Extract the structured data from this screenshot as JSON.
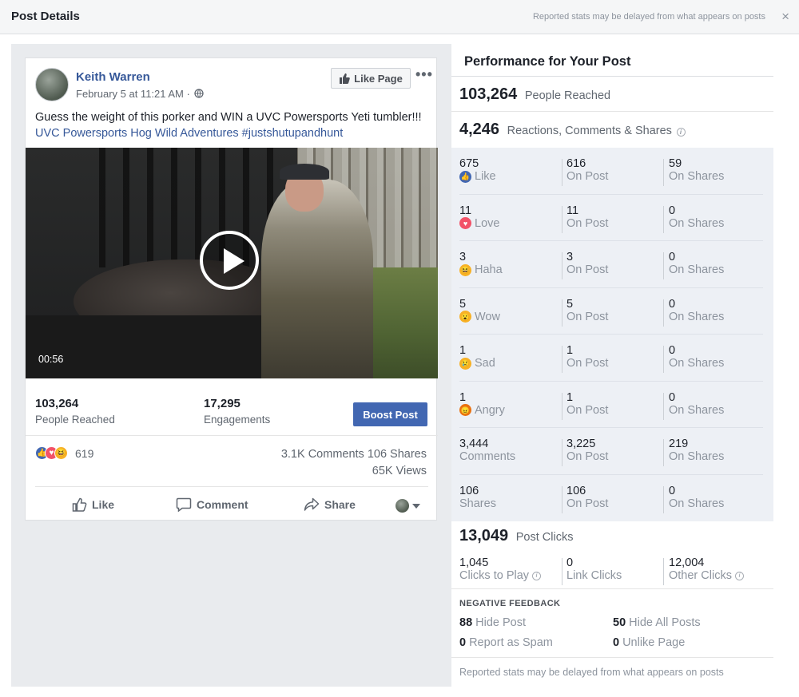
{
  "dialog": {
    "title": "Post Details",
    "header_note": "Reported stats may be delayed from what appears on posts",
    "close_glyph": "×"
  },
  "post": {
    "page_name": "Keith Warren",
    "date": "February 5 at 11:21 AM ·",
    "like_page_label": "Like Page",
    "more_glyph": "•••",
    "text": "Guess the weight of this porker and WIN a UVC Powersports Yeti tumbler!!!",
    "link_text": "UVC Powersports Hog Wild Adventures #justshutupandhunt",
    "video_time": "00:56",
    "people_reached_num": "103,264",
    "people_reached_label": "People Reached",
    "engagements_num": "17,295",
    "engagements_label": "Engagements",
    "boost_label": "Boost Post",
    "reaction_count": "619",
    "comments_shares": "3.1K Comments  106 Shares",
    "views": "65K Views",
    "actions": {
      "like": "Like",
      "comment": "Comment",
      "share": "Share"
    },
    "icons": [
      "globe-icon",
      "thumbs-up-icon",
      "comment-icon",
      "share-icon",
      "play-icon"
    ]
  },
  "performance": {
    "title": "Performance for Your Post",
    "reached_num": "103,264",
    "reached_label": "People Reached",
    "reactions_num": "4,246",
    "reactions_label": "Reactions, Comments & Shares",
    "rows": [
      {
        "icon": "like-icon",
        "color": "#4267b2",
        "glyph": "👍",
        "total": "675",
        "label": "Like",
        "post": "616",
        "post_label": "On Post",
        "shares": "59",
        "shares_label": "On Shares"
      },
      {
        "icon": "love-icon",
        "color": "#f25268",
        "glyph": "♥",
        "total": "11",
        "label": "Love",
        "post": "11",
        "post_label": "On Post",
        "shares": "0",
        "shares_label": "On Shares"
      },
      {
        "icon": "haha-icon",
        "color": "#f7b125",
        "glyph": "😆",
        "total": "3",
        "label": "Haha",
        "post": "3",
        "post_label": "On Post",
        "shares": "0",
        "shares_label": "On Shares"
      },
      {
        "icon": "wow-icon",
        "color": "#f7b125",
        "glyph": "😮",
        "total": "5",
        "label": "Wow",
        "post": "5",
        "post_label": "On Post",
        "shares": "0",
        "shares_label": "On Shares"
      },
      {
        "icon": "sad-icon",
        "color": "#f7b125",
        "glyph": "😢",
        "total": "1",
        "label": "Sad",
        "post": "1",
        "post_label": "On Post",
        "shares": "0",
        "shares_label": "On Shares"
      },
      {
        "icon": "angry-icon",
        "color": "#e9710f",
        "glyph": "😠",
        "total": "1",
        "label": "Angry",
        "post": "1",
        "post_label": "On Post",
        "shares": "0",
        "shares_label": "On Shares"
      },
      {
        "icon": "",
        "color": "",
        "glyph": "",
        "total": "3,444",
        "label": "Comments",
        "post": "3,225",
        "post_label": "On Post",
        "shares": "219",
        "shares_label": "On Shares"
      },
      {
        "icon": "",
        "color": "",
        "glyph": "",
        "total": "106",
        "label": "Shares",
        "post": "106",
        "post_label": "On Post",
        "shares": "0",
        "shares_label": "On Shares"
      }
    ],
    "clicks_num": "13,049",
    "clicks_label": "Post Clicks",
    "clicks": [
      {
        "num": "1,045",
        "label": "Clicks to Play",
        "info": true
      },
      {
        "num": "0",
        "label": "Link Clicks",
        "info": false
      },
      {
        "num": "12,004",
        "label": "Other Clicks",
        "info": true
      }
    ],
    "negative_title": "NEGATIVE FEEDBACK",
    "negative": [
      {
        "num": "88",
        "label": "Hide Post"
      },
      {
        "num": "50",
        "label": "Hide All Posts"
      },
      {
        "num": "0",
        "label": "Report as Spam"
      },
      {
        "num": "0",
        "label": "Unlike Page"
      }
    ],
    "footer": "Reported stats may be delayed from what appears on posts"
  },
  "colors": {
    "brand_blue": "#4267b2",
    "link_blue": "#365899",
    "grey_text": "#606770",
    "grid_bg": "#edf0f5"
  }
}
